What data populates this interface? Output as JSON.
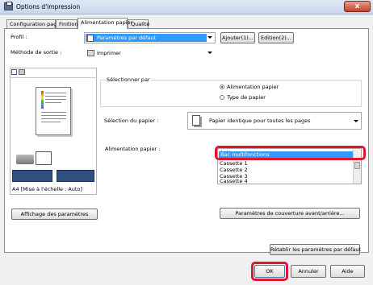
{
  "window": {
    "title": "Options d'impression",
    "close_label": "x"
  },
  "tabs": [
    {
      "label": "Configuration page"
    },
    {
      "label": "Finition"
    },
    {
      "label": "Alimentation papier"
    },
    {
      "label": "Qualité"
    }
  ],
  "profile": {
    "label": "Profil :",
    "value": "Paramètres par défaut",
    "add_button": "Ajouter(1)...",
    "edit_button": "Edition(2)..."
  },
  "output_method": {
    "label": "Méthode de sortie :",
    "value": "Imprimer"
  },
  "preview": {
    "caption": "A4 [Mise à l'échelle : Auto]"
  },
  "select_by": {
    "label": "Sélectionner par",
    "options": [
      "Alimentation papier",
      "Type de papier"
    ],
    "selected": "Alimentation papier"
  },
  "paper_selection": {
    "label": "Sélection du papier :",
    "value": "Papier identique pour toutes les pages"
  },
  "paper_source": {
    "label": "Alimentation papier :",
    "items": [
      "Auto",
      "Bac multifonctions",
      "Cassette 1",
      "Cassette 2",
      "Cassette 3",
      "Cassette 4"
    ],
    "selected": "Bac multifonctions"
  },
  "buttons": {
    "show_settings": "Affichage des paramètres",
    "cover_settings": "Paramètres de couverture avant/arrière...",
    "restore_defaults": "Rétablir les paramètres par défaut",
    "ok": "OK",
    "cancel": "Annuler",
    "help": "Aide"
  },
  "colors": {
    "highlight": "#3399ff",
    "annotation": "#e0142c"
  }
}
